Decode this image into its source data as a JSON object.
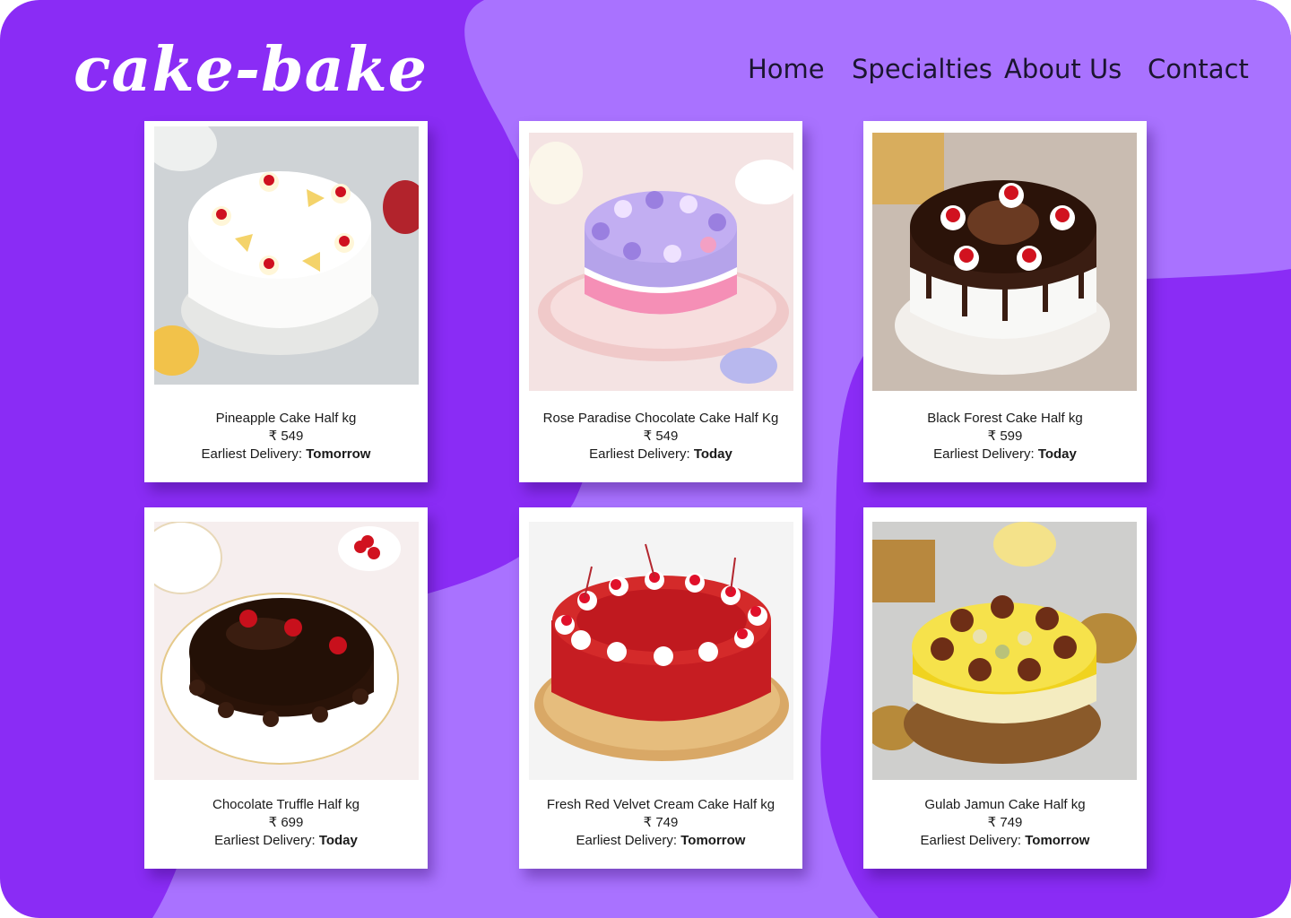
{
  "brand": {
    "logo_text": "cake-bake"
  },
  "nav": {
    "items": [
      "Home",
      "Specialties",
      "About Us",
      "Contact"
    ]
  },
  "delivery_label": "Earliest Delivery:",
  "products": [
    {
      "name": "Pineapple Cake Half kg",
      "price": "₹ 549",
      "delivery": "Tomorrow"
    },
    {
      "name": "Rose Paradise Chocolate Cake Half Kg",
      "price": "₹ 549",
      "delivery": "Today"
    },
    {
      "name": "Black Forest Cake Half kg",
      "price": "₹ 599",
      "delivery": "Today"
    },
    {
      "name": "Chocolate Truffle Half kg",
      "price": "₹ 699",
      "delivery": "Today"
    },
    {
      "name": "Fresh Red Velvet Cream Cake Half kg",
      "price": "₹ 749",
      "delivery": "Tomorrow"
    },
    {
      "name": "Gulab Jamun Cake Half kg",
      "price": "₹ 749",
      "delivery": "Tomorrow"
    }
  ],
  "colors": {
    "background": "#8a2cf5",
    "blob": "#a972ff",
    "card": "#ffffff",
    "nav_text": "#1b1530"
  }
}
